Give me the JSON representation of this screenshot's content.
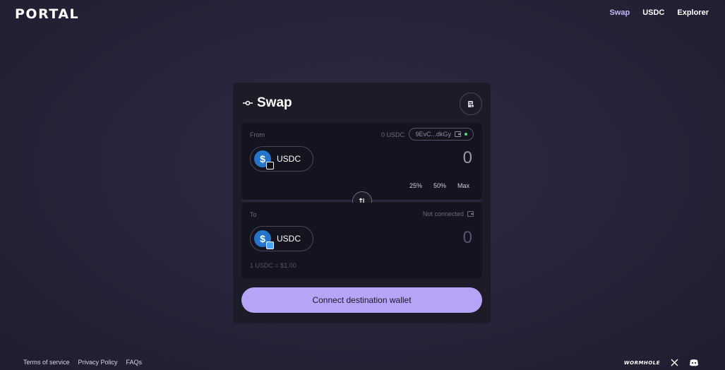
{
  "header": {
    "logo": "PORTAL",
    "nav": [
      {
        "label": "Swap",
        "active": true
      },
      {
        "label": "USDC",
        "active": false
      },
      {
        "label": "Explorer",
        "active": false
      }
    ]
  },
  "swap": {
    "title": "Swap",
    "from": {
      "label": "From",
      "balance": "0 USDC",
      "wallet": "9EvC...dkGy",
      "token": "USDC",
      "amount": "0",
      "percents": [
        "25%",
        "50%",
        "Max"
      ]
    },
    "to": {
      "label": "To",
      "wallet_status": "Not connected",
      "token": "USDC",
      "amount": "0",
      "rate": "1 USDC = $1.00"
    },
    "connect_button": "Connect destination wallet"
  },
  "footer": {
    "links": [
      "Terms of service",
      "Privacy Policy",
      "FAQs"
    ],
    "brand": "WORMHOLE"
  },
  "colors": {
    "accent": "#b6a4f7",
    "nav_active": "#c5b7f5",
    "usdc_blue": "#2775ca",
    "connected_dot": "#4ade80"
  }
}
